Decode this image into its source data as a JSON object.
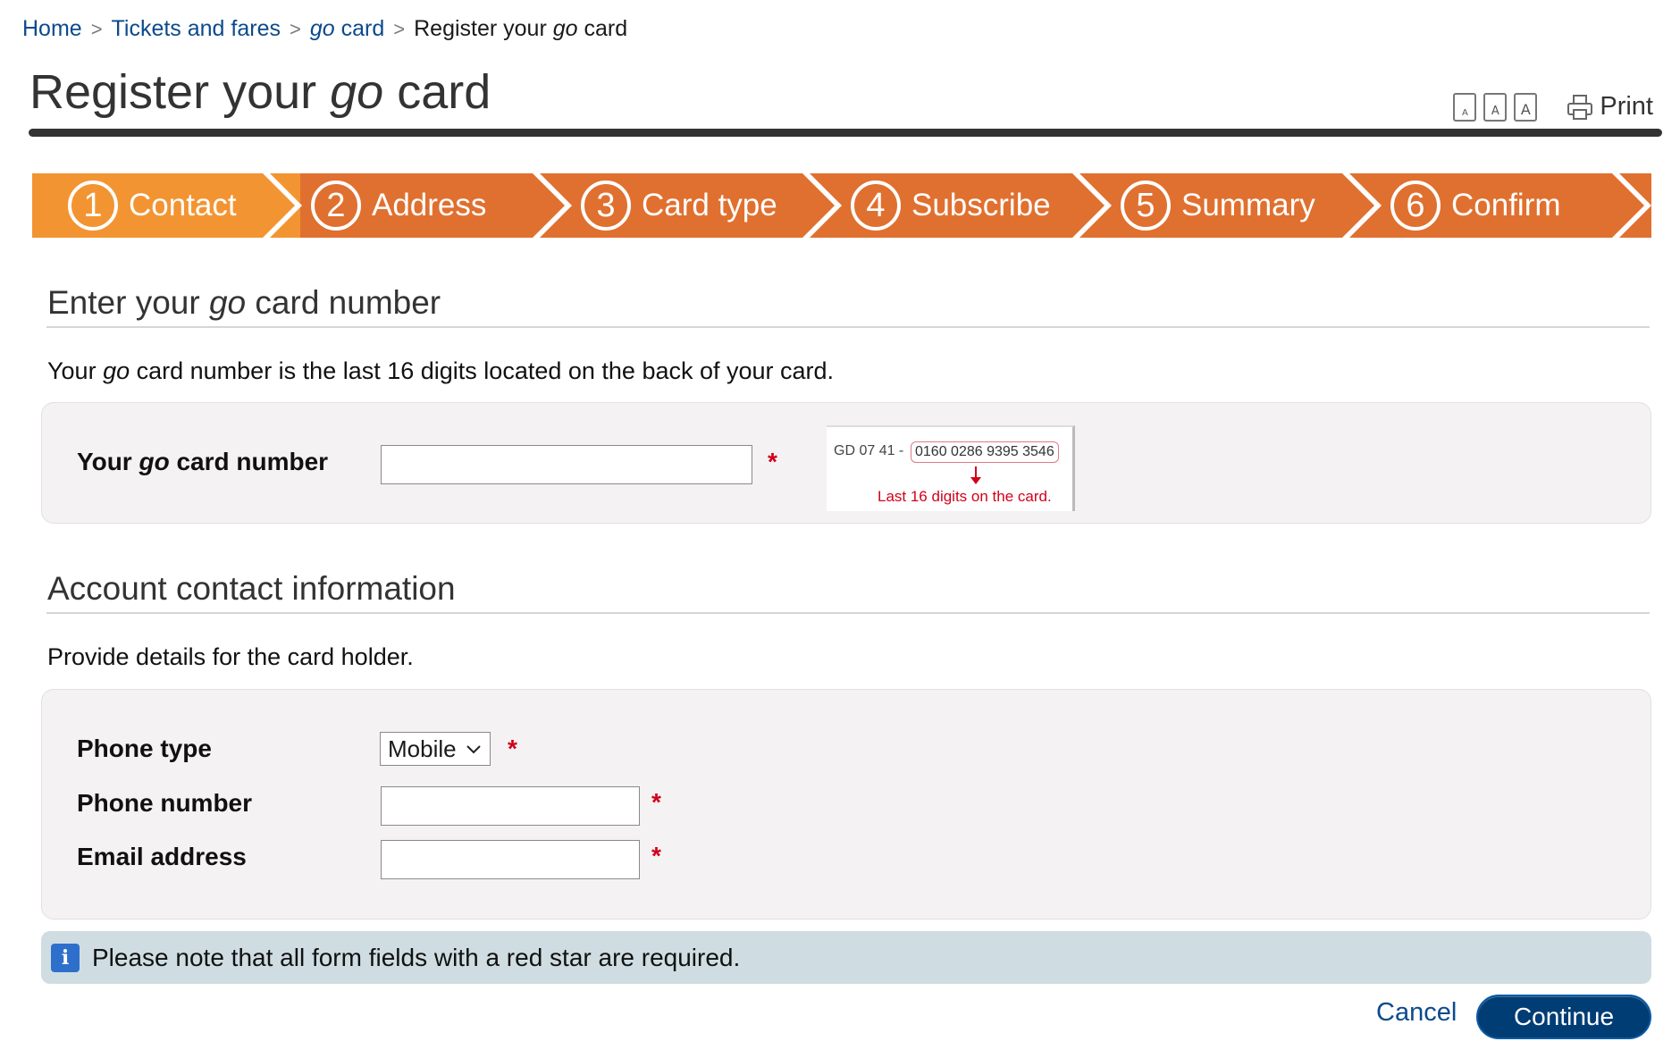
{
  "breadcrumb": {
    "home": "Home",
    "tickets": "Tickets and fares",
    "gocard_prefix": "go",
    "gocard_suffix": " card",
    "current_prefix": "Register your ",
    "current_go": "go",
    "current_suffix": " card"
  },
  "title": {
    "prefix": "Register your ",
    "go": "go",
    "suffix": " card"
  },
  "tools": {
    "print_label": "Print"
  },
  "steps": [
    {
      "number": "1",
      "label": "Contact"
    },
    {
      "number": "2",
      "label": "Address"
    },
    {
      "number": "3",
      "label": "Card type"
    },
    {
      "number": "4",
      "label": "Subscribe"
    },
    {
      "number": "5",
      "label": "Summary"
    },
    {
      "number": "6",
      "label": "Confirm"
    }
  ],
  "card_section": {
    "heading_prefix": "Enter your ",
    "heading_go": "go",
    "heading_suffix": " card number",
    "intro_prefix": "Your ",
    "intro_go": "go",
    "intro_suffix": " card number is the last 16 digits located on the back of your card.",
    "label_prefix": "Your ",
    "label_go": "go",
    "label_suffix": " card number",
    "value": "",
    "required_mark": "*",
    "card_image": {
      "code": "GD 07 41 -",
      "digits": "0160 0286 9395 3546",
      "note": "Last 16 digits on the card."
    }
  },
  "contact_section": {
    "heading": "Account contact information",
    "intro": "Provide details for the card holder.",
    "phone_type_label": "Phone type",
    "phone_type_value": "Mobile",
    "phone_number_label": "Phone number",
    "phone_number_value": "",
    "email_label": "Email address",
    "email_value": "",
    "required_mark": "*"
  },
  "notice": {
    "text": "Please note that all form fields with a red star are required."
  },
  "actions": {
    "cancel": "Cancel",
    "continue": "Continue"
  },
  "colors": {
    "accent_orange": "#e0702f",
    "active_step": "#f39432",
    "link_blue": "#0b4a8c",
    "button_navy": "#003d74",
    "required_red": "#d0021b"
  }
}
